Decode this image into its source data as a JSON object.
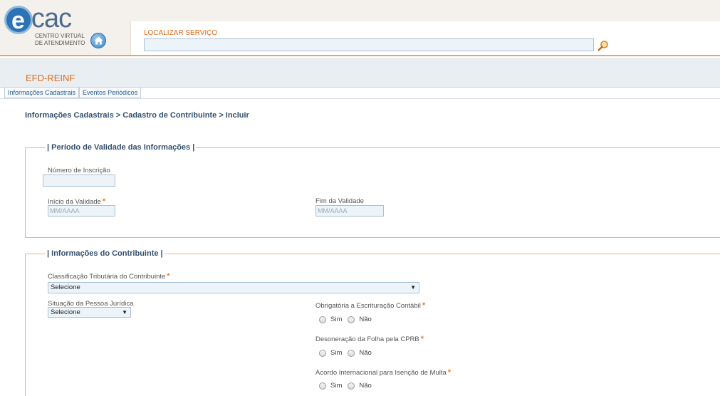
{
  "header": {
    "logo_e": "e",
    "logo_cac": "cac",
    "logo_sub_line1": "CENTRO VIRTUAL",
    "logo_sub_line2": "DE ATENDIMENTO",
    "search_label": "LOCALIZAR SERVIÇO",
    "search_value": ""
  },
  "module": {
    "title": "EFD-REINF"
  },
  "tabs": [
    {
      "label": "Informações Cadastrais"
    },
    {
      "label": "Eventos Periódicos"
    }
  ],
  "breadcrumb": "Informações Cadastrais > Cadastro de Contribuinte > Incluir",
  "section1": {
    "legend": "| Período de Validade das Informações |",
    "numero_inscricao_label": "Número de Inscrição",
    "numero_inscricao_value": "",
    "inicio_label": "Início da Validade",
    "inicio_placeholder": "MM/AAAA",
    "fim_label": "Fim da Validade",
    "fim_placeholder": "MM/AAAA",
    "required_mark": "*"
  },
  "section2": {
    "legend": "| Informações do Contribuinte |",
    "classificacao_label": "Classificação Tributária do Contribuinte",
    "classificacao_value": "Selecione",
    "situacao_label": "Situação da Pessoa Jurídica",
    "situacao_value": "Selecione",
    "escrituracao_label": "Obrigatória a Escrituração Contábil",
    "desoneracao_label": "Desoneração da Folha pela CPRB",
    "acordo_label": "Acordo Internacional para Isenção de Multa",
    "option_yes": "Sim",
    "option_no": "Não",
    "arrow": "▼",
    "required_mark": "*"
  },
  "icons": {
    "home": "home-icon",
    "search": "magnifier-icon"
  },
  "colors": {
    "accent_orange": "#e06b1c",
    "label_blue": "#33506e",
    "field_bg": "#edf4f9"
  }
}
